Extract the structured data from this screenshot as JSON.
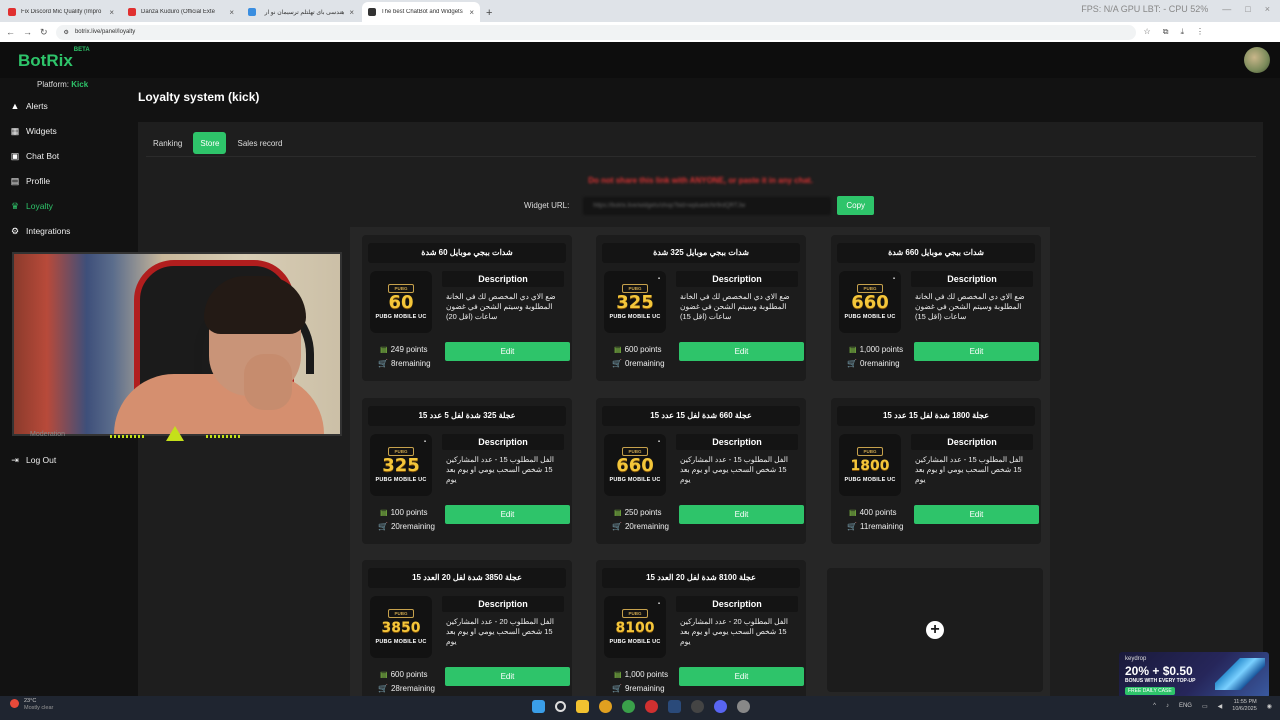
{
  "browser": {
    "tabs": [
      {
        "title": "Fix Discord Mic Quality (Impro",
        "color": "#e03030",
        "active": false
      },
      {
        "title": "Danza Kuduro (Official Exte",
        "color": "#e03030",
        "active": false
      },
      {
        "title": "هندسی بای تهلتلم ترسیمان نو آر",
        "color": "#3a8ee0",
        "active": false
      },
      {
        "title": "The best ChatBot and Widgets",
        "color": "#333333",
        "active": true
      }
    ],
    "url": "botrix.live/panel/loyalty",
    "window_stats": "FPS: N/A   GPU LBT: -   CPU 52%"
  },
  "app": {
    "logo": "BotRix",
    "logo_badge": "BETA",
    "platform_label": "Platform:",
    "platform_value": "Kick",
    "nav": [
      {
        "label": "Alerts",
        "icon": "alert-icon"
      },
      {
        "label": "Widgets",
        "icon": "widgets-icon"
      },
      {
        "label": "Chat Bot",
        "icon": "chat-icon"
      },
      {
        "label": "Profile",
        "icon": "profile-icon"
      },
      {
        "label": "Loyalty",
        "icon": "trophy-icon",
        "active": true
      },
      {
        "label": "Integrations",
        "icon": "integrations-icon"
      },
      {
        "label": "Log Out",
        "icon": "logout-icon"
      }
    ],
    "hidden_nav_partial": "Moderation"
  },
  "page": {
    "title": "Loyalty system (kick)",
    "tabs": [
      {
        "label": "Ranking",
        "active": false
      },
      {
        "label": "Store",
        "active": true
      },
      {
        "label": "Sales record",
        "active": false
      }
    ],
    "warning": "Do not share this link with ANYONE, or paste it in any chat.",
    "widget_url_label": "Widget URL:",
    "widget_url_value": "https://botrix.live/widgets/shop?bid=wpluedcNr9rdQRTJw",
    "copy_label": "Copy"
  },
  "store": {
    "description_label": "Description",
    "edit_label": "Edit",
    "add_label": "+",
    "items": [
      {
        "name": "شدات ببجي موبايل 60 شدة",
        "amount": "60",
        "desc": "ضع الاي دي المخصص لك في الخانة المطلوبة وسيتم الشحن في غضون ساعات (اقل 20)",
        "points": "249 points",
        "remaining": "8remaining"
      },
      {
        "name": "شدات ببجي موبايل 325 شدة",
        "amount": "325",
        "desc": "ضع الاي دي المخصص لك في الخانة المطلوبة وسيتم الشحن في غضون ساعات (اقل 15)",
        "points": "600 points",
        "remaining": "0remaining"
      },
      {
        "name": "شدات ببجي موبايل 660 شدة",
        "amount": "660",
        "desc": "ضع الاي دي المخصص لك في الخانة المطلوبة وسيتم الشحن في غضون ساعات (اقل 15)",
        "points": "1,000 points",
        "remaining": "0remaining"
      },
      {
        "name": "عجلة 325 شدة لفل 5 عدد 15",
        "amount": "325",
        "desc": "الفل المطلوب 15 - عدد المشاركين 15 شخص السحب يومي او يوم بعد يوم",
        "points": "100 points",
        "remaining": "20remaining"
      },
      {
        "name": "عجلة 660 شدة لفل 15 عدد 15",
        "amount": "660",
        "desc": "الفل المطلوب 15 - عدد المشاركين 15 شخص السحب يومي او يوم بعد يوم",
        "points": "250 points",
        "remaining": "20remaining"
      },
      {
        "name": "عجلة 1800 شدة لفل 15 عدد 15",
        "amount": "1800",
        "desc": "الفل المطلوب 15 - عدد المشاركين 15 شخص السحب يومي او يوم بعد يوم",
        "points": "400 points",
        "remaining": "11remaining"
      },
      {
        "name": "عجلة 3850 شدة لفل 20 العدد 15",
        "amount": "3850",
        "desc": "الفل المطلوب 20 - عدد المشاركين 15 شخص السحب يومي او يوم بعد يوم",
        "points": "600 points",
        "remaining": "28remaining"
      },
      {
        "name": "عجلة 8100 شدة لفل 20 العدد 15",
        "amount": "8100",
        "desc": "الفل المطلوب 20 - عدد المشاركين 15 شخص السحب يومي او يوم بعد يوم",
        "points": "1,000 points",
        "remaining": "9remaining"
      }
    ],
    "badge_top": "PUBG",
    "badge_bottom": "PUBG MOBILE UC"
  },
  "taskbar": {
    "temp": "23°C",
    "weather": "Mostly clear",
    "lang": "ENG",
    "time": "11:55 PM",
    "date": "10/6/2025"
  },
  "ad": {
    "brand": "keydrop",
    "promo": "20% + $0.50",
    "sub": "BONUS WITH EVERY TOP-UP",
    "case": "FREE DAILY CASE"
  },
  "colors": {
    "accent": "#2ec46a",
    "warning": "#dd3333"
  }
}
